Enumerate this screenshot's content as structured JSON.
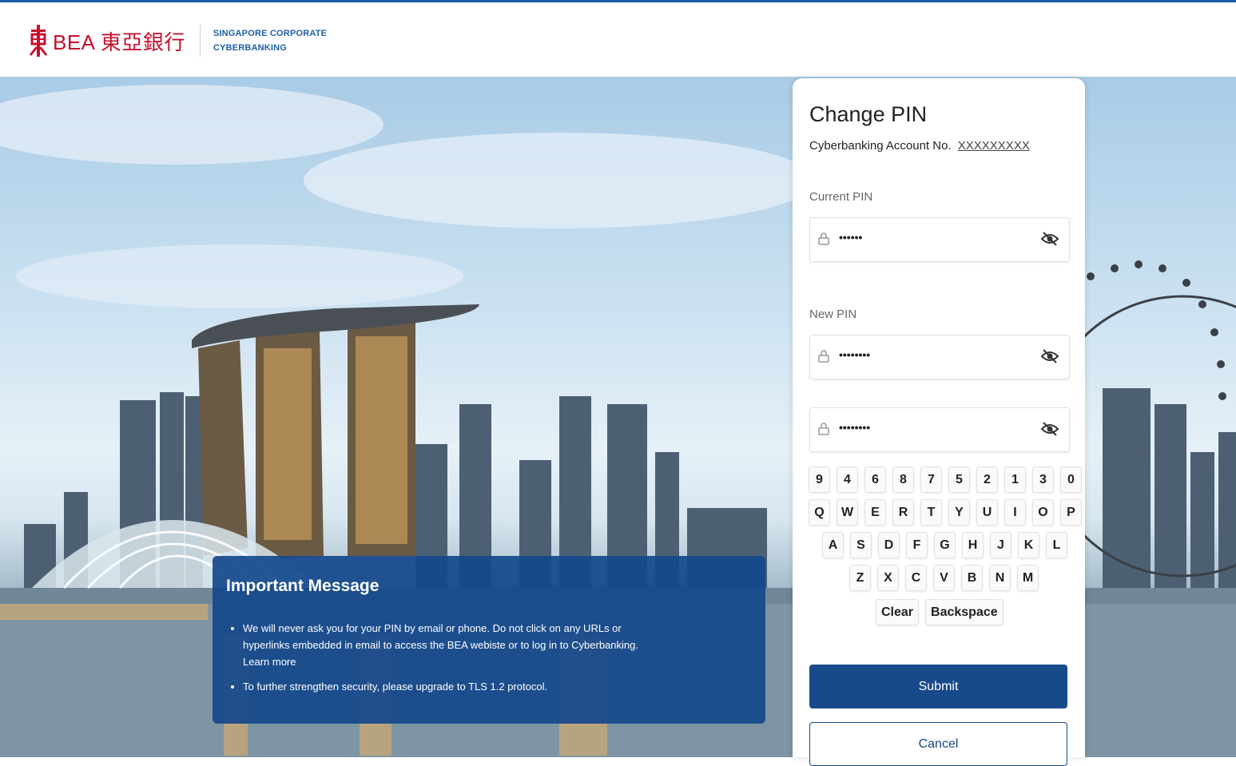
{
  "header": {
    "brand": "BEA 東亞銀行",
    "sub_line1": "SINGAPORE CORPORATE",
    "sub_line2": "CYBERBANKING"
  },
  "panel": {
    "title": "Change PIN",
    "account_label": "Cyberbanking Account No.",
    "account_number": "XXXXXXXXX",
    "current_pin_label": "Current PIN",
    "current_pin_value": "••••••",
    "new_pin_label": "New PIN",
    "new_pin_value": "••••••••",
    "confirm_pin_value": "••••••••",
    "keyboard": {
      "row1": [
        "9",
        "4",
        "6",
        "8",
        "7",
        "5",
        "2",
        "1",
        "3",
        "0"
      ],
      "row2": [
        "Q",
        "W",
        "E",
        "R",
        "T",
        "Y",
        "U",
        "I",
        "O",
        "P"
      ],
      "row3": [
        "A",
        "S",
        "D",
        "F",
        "G",
        "H",
        "J",
        "K",
        "L"
      ],
      "row4": [
        "Z",
        "X",
        "C",
        "V",
        "B",
        "N",
        "M"
      ],
      "clear": "Clear",
      "backspace": "Backspace"
    },
    "submit": "Submit",
    "cancel": "Cancel"
  },
  "message": {
    "title": "Important Message",
    "item1": "We will never ask you for your PIN by email or phone. Do not click on any URLs or hyperlinks embedded in email to access the BEA webiste or to log in to Cyberbanking.",
    "item1_link": "Learn more",
    "item2": "To further strengthen security, please upgrade to TLS 1.2 protocol."
  },
  "colors": {
    "brand_red": "#c8102e",
    "primary_blue": "#174a8b",
    "message_blue": "#14488c"
  }
}
